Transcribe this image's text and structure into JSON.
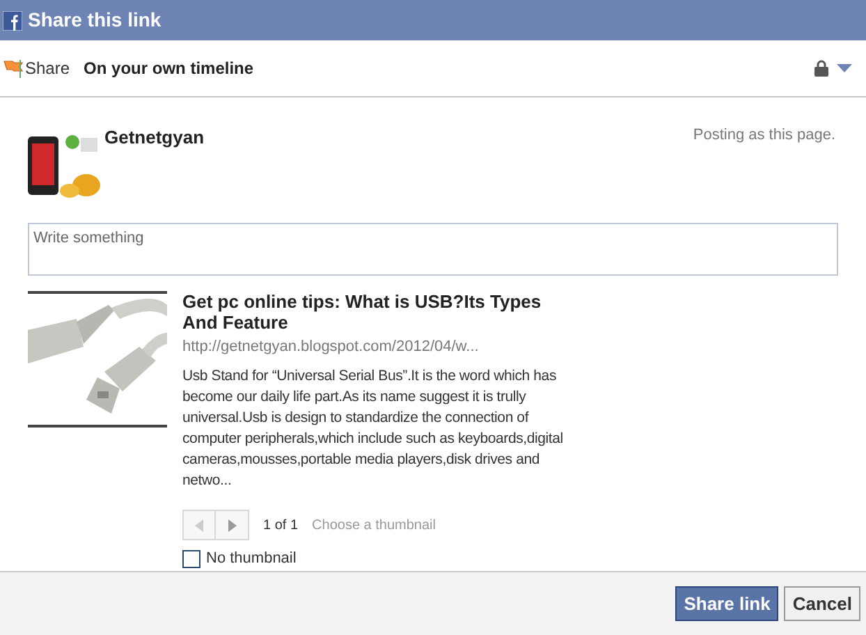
{
  "window": {
    "title": "Share this link"
  },
  "share_bar": {
    "label": "Share",
    "destination": "On your own timeline"
  },
  "poster": {
    "name": "Getnetgyan",
    "note": "Posting as this page."
  },
  "composer": {
    "placeholder": "Write something"
  },
  "link_preview": {
    "title": "Get pc online tips: What is USB?Its Types And Feature",
    "url": "http://getnetgyan.blogspot.com/2012/04/w...",
    "summary": "Usb Stand for “Universal Serial Bus”.It is the word which has become our daily life part.As its name suggest it is trully universal.Usb is design to standardize the connection of computer peripherals,which include such as keyboards,digital cameras,mousses,portable media players,disk drives and netwo...",
    "pager": {
      "count": "1 of 1",
      "hint": "Choose a thumbnail",
      "previous_disabled": true,
      "next_disabled": false
    },
    "no_thumbnail": {
      "label": "No thumbnail",
      "checked": false
    }
  },
  "buttons": [
    {
      "label": "Share link",
      "kind": "primary"
    },
    {
      "label": "Cancel",
      "kind": "secondary"
    }
  ]
}
